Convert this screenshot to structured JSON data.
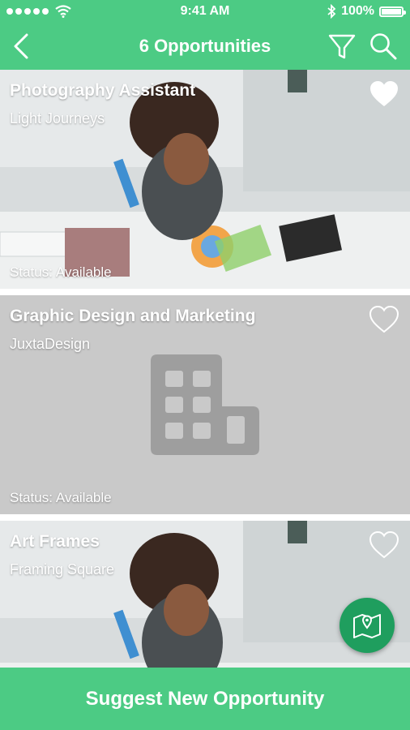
{
  "status_bar": {
    "time": "9:41 AM",
    "battery": "100%",
    "icons": [
      "signal-dots-icon",
      "wifi-icon",
      "bluetooth-icon",
      "battery-icon"
    ]
  },
  "header": {
    "title": "6 Opportunities",
    "icons": [
      "back-chevron-icon",
      "filter-icon",
      "search-icon"
    ]
  },
  "opportunities": [
    {
      "title": "Photography Assistant",
      "organization": "Light Journeys",
      "status_label": "Status:",
      "status_value": "Available",
      "favorited": true,
      "image": "office-photo"
    },
    {
      "title": "Graphic Design and Marketing",
      "organization": "JuxtaDesign",
      "status_label": "Status:",
      "status_value": "Available",
      "favorited": false,
      "image": "building-placeholder-icon"
    },
    {
      "title": "Art Frames",
      "organization": "Framing Square",
      "favorited": false,
      "image": "office-photo"
    }
  ],
  "map_button": {
    "icon": "map-pin-icon"
  },
  "bottom_bar": {
    "label": "Suggest New Opportunity"
  },
  "colors": {
    "brand_green": "#4ccb84",
    "fab_green": "#1f9e5e",
    "placeholder_gray": "#c9c9c9",
    "placeholder_icon": "#9e9e9e"
  }
}
